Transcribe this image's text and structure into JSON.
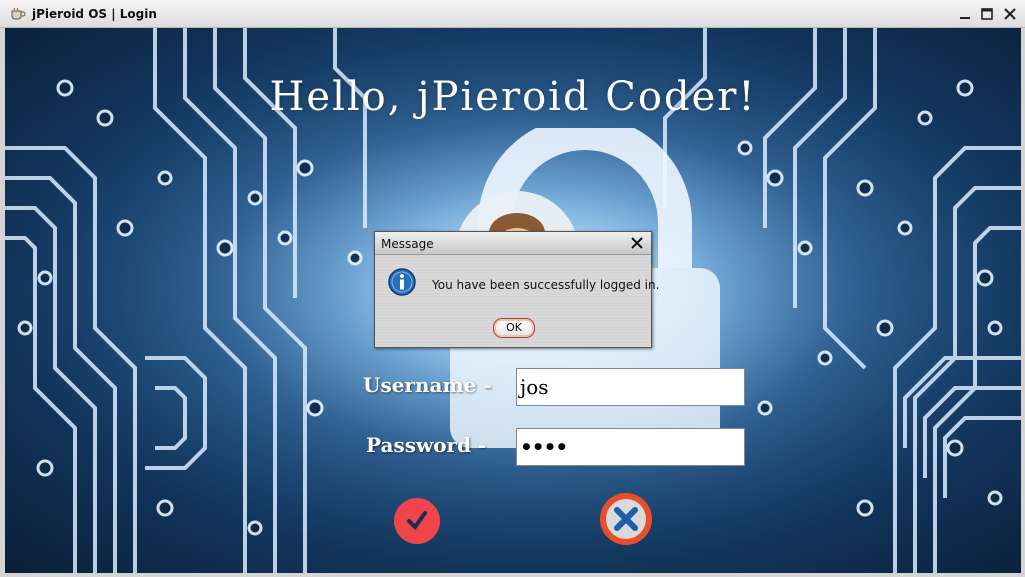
{
  "window": {
    "title": "jPieroid OS | Login",
    "icons": {
      "app": "coffee-cup-icon",
      "minimize": "minimize-icon",
      "maximize": "maximize-icon",
      "close": "close-icon"
    }
  },
  "login": {
    "greeting": "Hello, jPieroid Coder!",
    "username_label": "Username -",
    "username_value": "jos",
    "password_label": "Password -",
    "password_value": "••••",
    "submit_icon": "checkmark-icon",
    "cancel_icon": "x-mark-icon",
    "colors": {
      "submit": "#f0454b",
      "cancel": "#e94e2b"
    }
  },
  "dialog": {
    "title": "Message",
    "message": "You have been successfully logged in.",
    "ok_label": "OK",
    "icon": "info-icon"
  }
}
